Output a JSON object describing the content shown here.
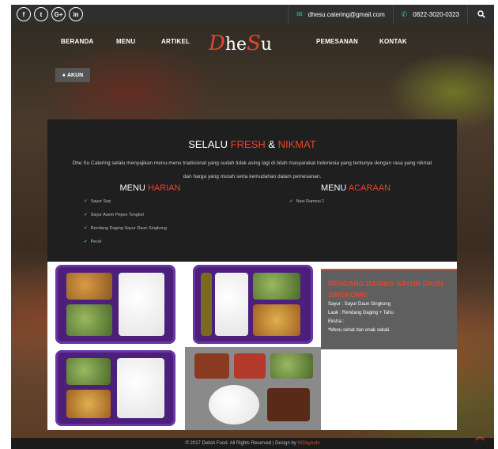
{
  "topbar": {
    "social": [
      "f",
      "t",
      "G+",
      "in"
    ],
    "email": "dhesu.catering@gmail.com",
    "phone": "0822-3020-0323",
    "email_icon": "envelope-icon",
    "phone_icon": "phone-icon",
    "search_icon": "search-icon"
  },
  "nav": {
    "beranda": "BERANDA",
    "menu": "MENU",
    "artikel": "ARTIKEL",
    "pemesanan": "PEMESANAN",
    "kontak": "KONTAK",
    "logo_first": "D",
    "logo_mid": "he",
    "logo_last": "S",
    "logo_end": "u",
    "akun": "AKUN"
  },
  "hero": {
    "headline_a": "SELALU ",
    "headline_b": "FRESH",
    "headline_c": " & ",
    "headline_d": "NIKMAT",
    "intro": "Dhe Su Catering selalu menyajikan menu-menu tradisional yang sudah tidak asing lagi di lidah masyarakat Indonesia yang tentunya dengan rasa yang nikmat dan harga yang murah serta kemudahan dalam pemesanan."
  },
  "menu_harian": {
    "title_a": "MENU ",
    "title_b": "HARIAN",
    "items": [
      "Sayur Sop",
      "Sayur Asem Pepes Tongkol",
      "Rendang Daging Sayur Daun Singkong",
      "Pecel"
    ]
  },
  "menu_acaraan": {
    "title_a": "MENU ",
    "title_b": "ACARAAN",
    "items": [
      "Nasi Ramesi 1"
    ]
  },
  "feature": {
    "title": "RENDANG DAGING SAYUR DAUN SINGKONG",
    "sayur": "Sayur : Sayur Daun Singkong",
    "lauk": "Lauk : Rendang Daging + Tahu",
    "ekstra": "Ekstra :",
    "note": "*Menu sehat dan enak sekali."
  },
  "footer": {
    "text": "© 2017 Delish Food. All Rights Reserved | Design by ",
    "link": "W3layouts"
  },
  "colors": {
    "accent": "#e8442b",
    "check": "#2ecc71",
    "panel": "#1f1f1f"
  }
}
